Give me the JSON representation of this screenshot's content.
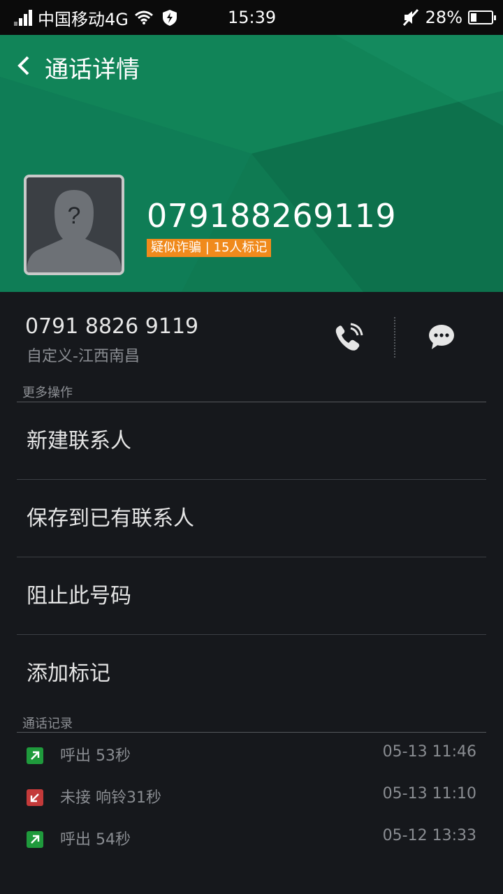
{
  "status_bar": {
    "carrier": "中国移动4G",
    "time": "15:39",
    "battery": "28%",
    "battery_level": 0.28,
    "icons": [
      "signal-icon",
      "wifi-icon",
      "shield-icon",
      "mute-icon",
      "battery-icon"
    ]
  },
  "header": {
    "title": "通话详情",
    "phone_number": "079188269119",
    "tag": "疑似诈骗 | 15人标记",
    "colors": {
      "background": "#0f7a52",
      "tag": "#f08a1c"
    }
  },
  "number_row": {
    "formatted_number": "0791 8826 9119",
    "location": "自定义-江西南昌"
  },
  "more_actions": {
    "label": "更多操作",
    "items": [
      {
        "label": "新建联系人"
      },
      {
        "label": "保存到已有联系人"
      },
      {
        "label": "阻止此号码"
      },
      {
        "label": "添加标记"
      }
    ]
  },
  "call_log": {
    "label": "通话记录",
    "entries": [
      {
        "type": "outgoing",
        "text": "呼出 53秒",
        "time": "05-13 11:46"
      },
      {
        "type": "missed",
        "text": "未接 响铃31秒",
        "time": "05-13 11:10"
      },
      {
        "type": "outgoing",
        "text": "呼出 54秒",
        "time": "05-12 13:33"
      }
    ]
  }
}
